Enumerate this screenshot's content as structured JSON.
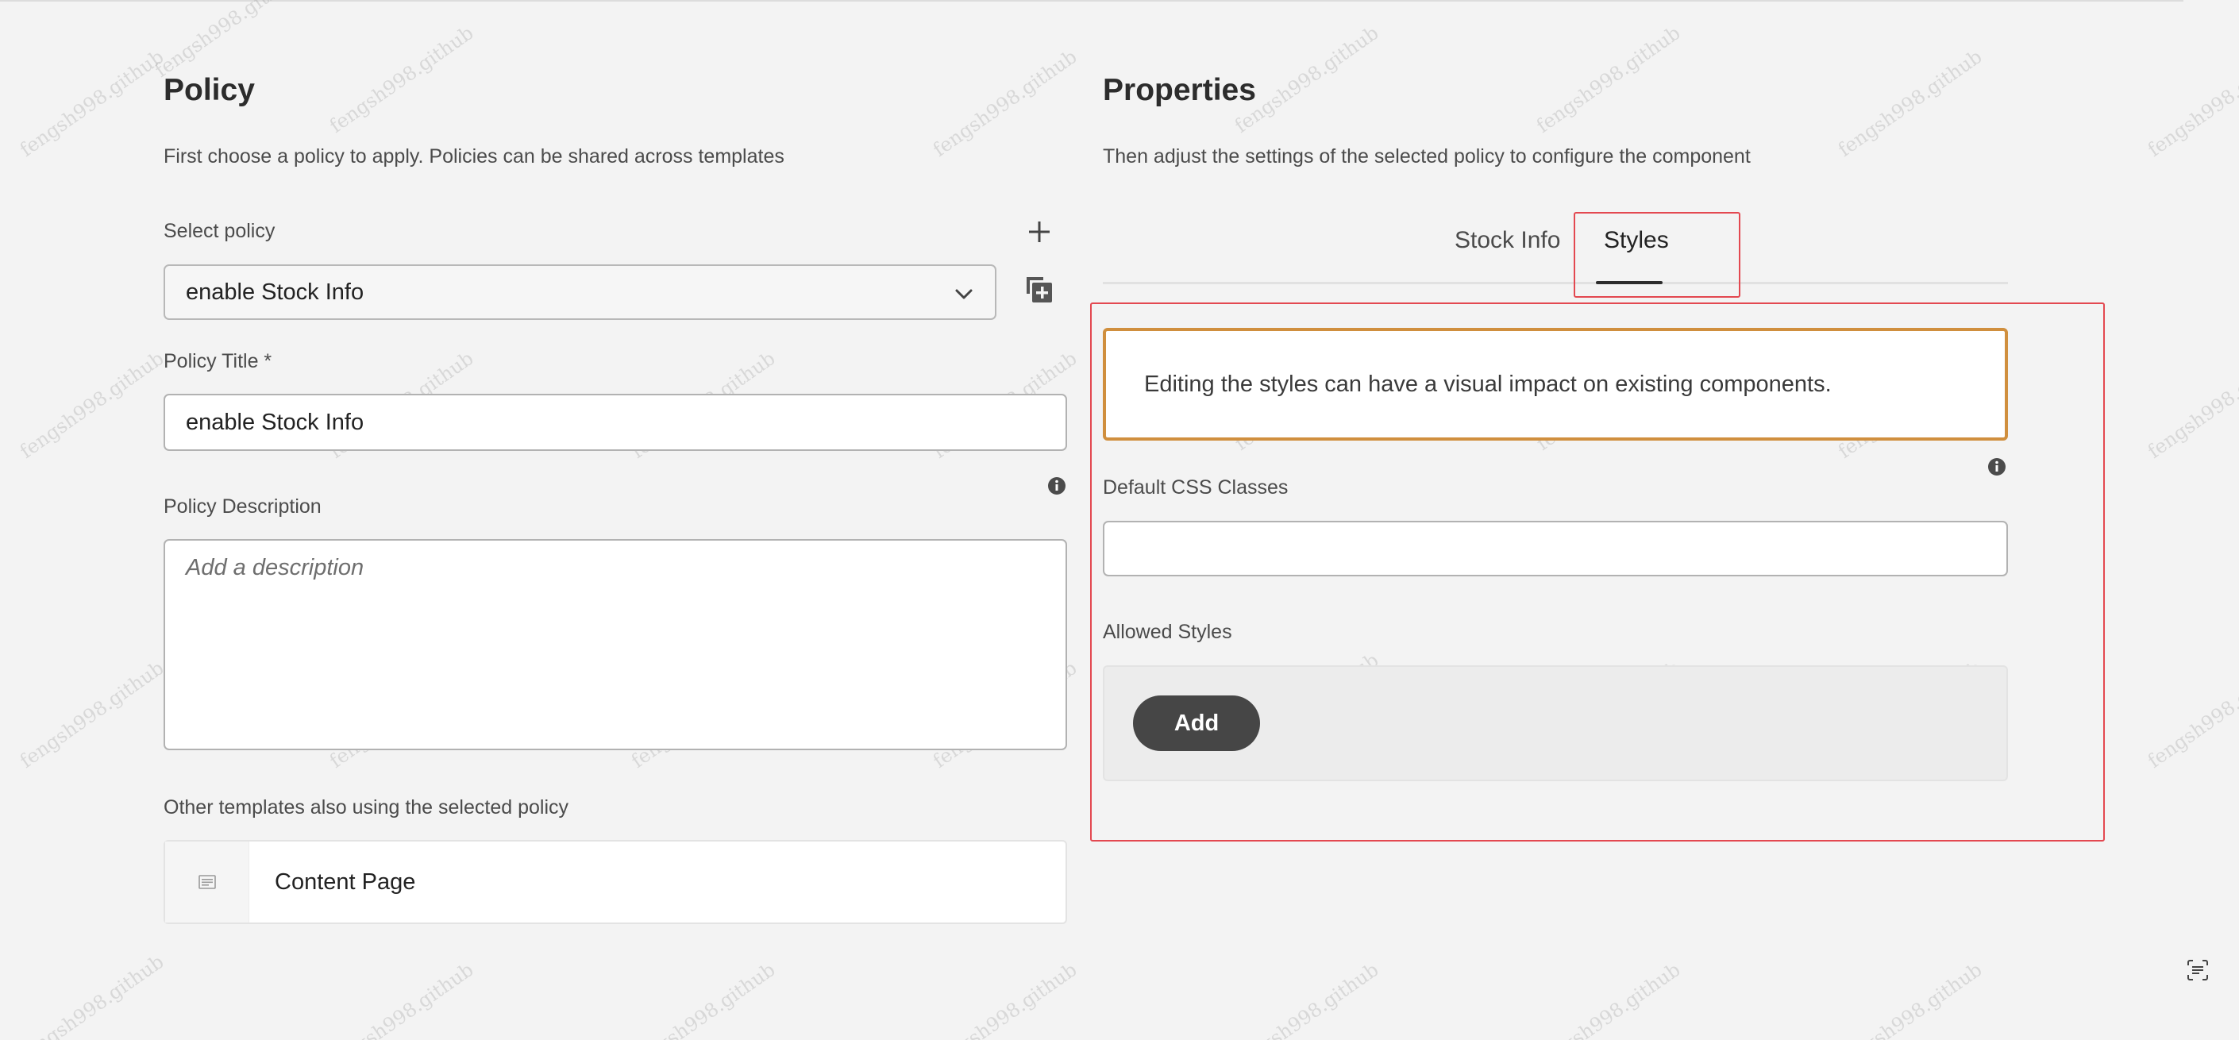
{
  "policy": {
    "title": "Policy",
    "description": "First choose a policy to apply. Policies can be shared across templates",
    "select_label": "Select policy",
    "selected_value": "enable Stock Info",
    "title_label": "Policy Title *",
    "title_value": "enable Stock Info",
    "description_label": "Policy Description",
    "description_placeholder": "Add a description",
    "other_templates_label": "Other templates also using the selected policy",
    "templates": [
      {
        "label": "Content Page",
        "icon": "template-icon"
      }
    ]
  },
  "properties": {
    "title": "Properties",
    "description": "Then adjust the settings of the selected policy to configure the component",
    "tabs": [
      {
        "label": "Stock Info",
        "active": false
      },
      {
        "label": "Styles",
        "active": true
      }
    ],
    "warning": "Editing the styles can have a visual impact on existing components.",
    "css_classes_label": "Default CSS Classes",
    "css_classes_value": "",
    "allowed_styles_label": "Allowed Styles",
    "add_label": "Add"
  },
  "watermark": "fengsh998.github",
  "colors": {
    "highlight": "#e34850",
    "warning_border": "#d08f3e",
    "button_dark": "#464646"
  }
}
